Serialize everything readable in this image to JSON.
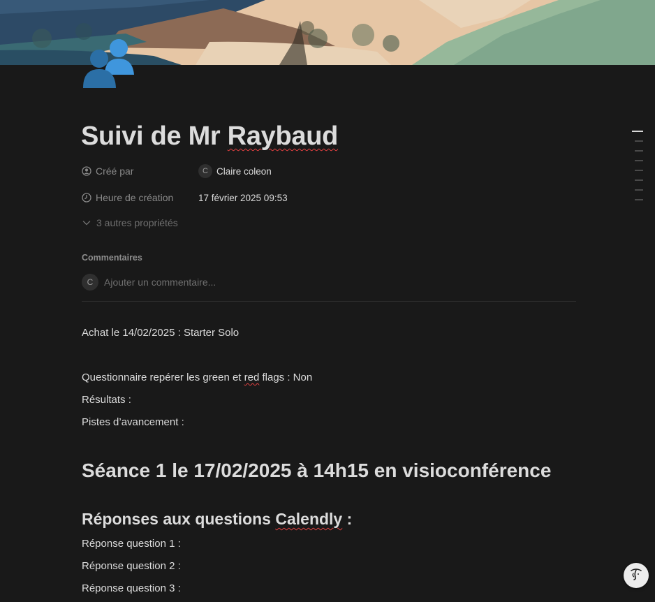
{
  "page": {
    "title": "Suivi de Mr Raybaud",
    "title_plain": "Suivi de Mr ",
    "title_flagged": "Raybaud",
    "icon": "two-people-icon",
    "cover": "hokusai-fuji-landscape"
  },
  "properties": [
    {
      "name": "Créé par",
      "icon": "person-circle-icon",
      "avatar": "C",
      "value": "Claire coleon"
    },
    {
      "name": "Heure de création",
      "icon": "clock-icon",
      "value": "17 février 2025 09:53"
    }
  ],
  "more_properties": "3 autres propriétés",
  "comments": {
    "label": "Commentaires",
    "avatar": "C",
    "placeholder": "Ajouter un commentaire..."
  },
  "content": {
    "purchase": "Achat le 14/02/2025 : Starter Solo",
    "questionnaire": {
      "a": "Questionnaire repérer les green et ",
      "flag": "red",
      "b": " flags : Non"
    },
    "results": "Résultats :",
    "pistes": "Pistes d’avancement :",
    "session_heading": "Séance 1 le 17/02/2025 à 14h15 en visioconférence",
    "calendly_heading": {
      "a": "Réponses aux questions ",
      "flag": "Calendly",
      "b": " :"
    },
    "answers": [
      "Réponse question 1 :",
      "Réponse question 2 :",
      "Réponse question 3 :"
    ]
  },
  "colors": {
    "background": "#191919",
    "text": "#dcdcdc",
    "muted": "#8a8a8a",
    "spellcheck": "#e04040",
    "icon_blue": "#3b8fd6"
  }
}
